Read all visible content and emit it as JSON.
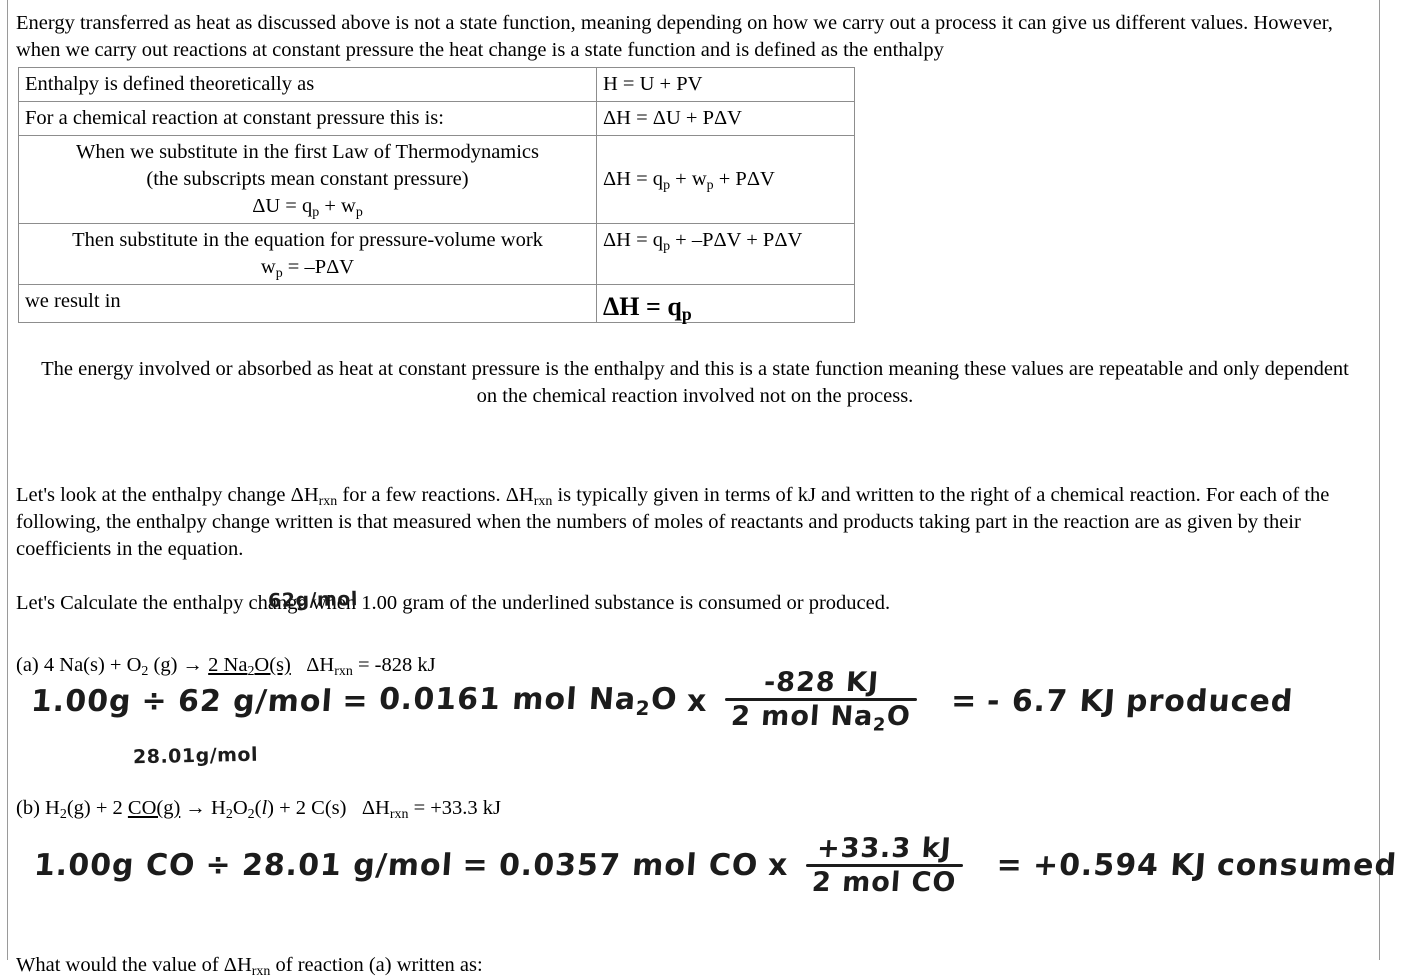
{
  "document": {
    "intro_paragraph": "Energy transferred as heat as discussed above is not a state function, meaning depending on how we carry out a process it can give us different values. However, when we carry out reactions at constant pressure the heat change is a state function and is defined as the enthalpy",
    "summary_paragraph": "The energy involved or absorbed as heat at constant pressure is the enthalpy and this is a state function meaning these values are repeatable and only dependent on the chemical reaction involved not on the process.",
    "instruction_paragraph_part1": "Let's look at the enthalpy change ΔH",
    "instruction_paragraph_sub1": "rxn",
    "instruction_paragraph_part2": " for a few reactions. ΔH",
    "instruction_paragraph_sub2": "rxn",
    "instruction_paragraph_part3": " is typically given in terms of kJ and written to the right of a chemical reaction. For each of the following, the enthalpy change written is that measured when the numbers of moles of reactants and products taking part in the reaction are as given by their coefficients in the equation.",
    "calculate_prompt": "Let's Calculate the enthalpy change when 1.00 gram of the underlined substance is consumed or produced.",
    "closing_question_part1": "What would the value of  ΔH",
    "closing_question_sub": "rxn",
    "closing_question_part2": " of reaction (a) written as:"
  },
  "enthalpy_table": {
    "rows": [
      {
        "label": "Enthalpy is defined theoretically as",
        "label_lines": [
          "Enthalpy is defined theoretically as"
        ],
        "equation": "H = U + PV"
      },
      {
        "label": "For a chemical reaction at constant pressure this is:",
        "label_lines": [
          "For a chemical reaction at constant pressure this is:"
        ],
        "equation": "ΔH = ΔU + PΔV"
      },
      {
        "label": "When we substitute in the first Law of Thermodynamics (the subscripts mean constant pressure) ΔU = qp + wp",
        "label_lines": [
          "When we substitute in the first Law of Thermodynamics",
          "(the subscripts mean constant pressure)",
          "ΔU = q",
          "p",
          " + w",
          "p"
        ],
        "equation": "ΔH = qp + wp + PΔV"
      },
      {
        "label": "Then substitute in the equation for pressure-volume work wp = –PΔV",
        "label_lines": [
          "Then substitute in the equation for pressure-volume work",
          "w",
          "p",
          " = –PΔV"
        ],
        "equation": "ΔH = qp + –PΔV + PΔV"
      },
      {
        "label": "we result in",
        "label_lines": [
          "we result in"
        ],
        "equation": "ΔH = qp"
      }
    ],
    "r1_label": "Enthalpy is defined theoretically as",
    "r1_eq": "H = U + PV",
    "r2_label": "For a chemical reaction at constant pressure this is:",
    "r3_label_line1": "When we substitute in the first Law of Thermodynamics",
    "r3_label_line2": "(the subscripts mean constant pressure)",
    "r4_label_line1": "Then substitute in the equation for pressure-volume work",
    "r5_label": "we result in"
  },
  "reaction_a": {
    "label": "(a)",
    "equation_prefix": "4 Na(s) + O",
    "equation_o_sub": "2",
    "equation_mid": " (g) → ",
    "underlined": "2 Na2O(s)",
    "delta_h_label": "ΔH",
    "delta_h_sub": "rxn",
    "delta_h_value": "= -828 kJ",
    "molar_mass_note": "62g/mol"
  },
  "reaction_b": {
    "label": "(b)",
    "underlined": "CO(g)",
    "delta_h_label": "ΔH",
    "delta_h_sub": "rxn",
    "delta_h_value": "= +33.3 kJ",
    "molar_mass_note": "28.01g/mol"
  },
  "handwork_a": {
    "mass": "1.00g",
    "divide": "÷",
    "molar_mass": "62 g/mol",
    "equals": "=",
    "moles": "0.0161 mol Na",
    "moles_sub": "2",
    "moles_tail": "O",
    "times": "x",
    "frac_num": "-828 KJ",
    "frac_den_pre": "2 mol Na",
    "frac_den_sub": "2",
    "frac_den_post": "O",
    "result_equals": "=",
    "result": "- 6.7 KJ",
    "result_word": "produced"
  },
  "handwork_b": {
    "mass": "1.00g CO",
    "divide": "÷",
    "molar_mass": "28.01 g/mol",
    "equals": "=",
    "moles": "0.0357 mol CO",
    "times": "x",
    "frac_num": "+33.3 kJ",
    "frac_den": "2 mol CO",
    "result_equals": "=",
    "result": "+0.594 KJ",
    "result_word": "consumed"
  },
  "colors": {
    "ink": "#1c1c1c",
    "rule": "#9a9a9a",
    "table_border": "#8d8d8d",
    "page_bg": "#ffffff"
  }
}
